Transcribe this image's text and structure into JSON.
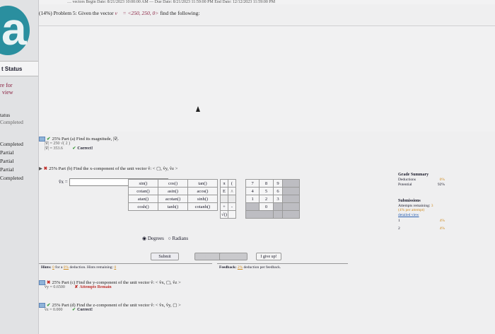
{
  "top_strip": "… vectors Begin Date: 8/21/2023 10:00:00 AM — Due Date: 8/21/2023 11:59:00 PM   End Date: 12/12/2023 11:59:00 PM",
  "sidebar": {
    "logo_letter": "a",
    "status_header": "t Status",
    "review_link_1": "re for",
    "review_link_2": "view",
    "status_label_1": "tatus",
    "status_label_2": "Completed",
    "items": [
      "Completed",
      "Partial",
      "Partial",
      "Partial",
      "Completed"
    ]
  },
  "problem": {
    "title_prefix": "(14%)  Problem 5:  Given the vector ",
    "vector_expr": "v⃗ = <250, 250, 0>",
    "title_suffix": " find the following:"
  },
  "parts": {
    "a": {
      "label": "25% Part (a)  Find its magnitude, |v⃗|.",
      "line1": "|v⃗| = 250 √( 2 )",
      "line2": "|v⃗| = 353.6",
      "status": "Correct!"
    },
    "b": {
      "label": "25% Part (b)  Find the x-component of the unit vector v̂: < ▢, v̂y, v̂z >",
      "answer_label": "v̂x = "
    },
    "c": {
      "label": "25% Part (c)  Find the y-component of the unit vector v̂: < v̂x, ▢, v̂z >",
      "line1": "v̂y = 0.6500",
      "status": "Attempts Remain"
    },
    "d": {
      "label": "25% Part (d)  Find the z-component of the unit vector v̂: < v̂x, v̂y, ▢ >",
      "line1": "v̂z = 0.000",
      "status": "Correct!"
    }
  },
  "keypad": {
    "functions": [
      [
        "sin()",
        "cos()",
        "tan()"
      ],
      [
        "cotan()",
        "asin()",
        "acos()"
      ],
      [
        "atan()",
        "acotan()",
        "sinh()"
      ],
      [
        "cosh()",
        "tanh()",
        "cotanh()"
      ]
    ],
    "symbols": [
      "π",
      "(",
      "E",
      "∧",
      "+",
      "-",
      "√()"
    ],
    "digits": [
      [
        "7",
        "8",
        "9"
      ],
      [
        "4",
        "5",
        "6"
      ],
      [
        "1",
        "2",
        "3"
      ],
      [
        "",
        "0",
        ""
      ]
    ],
    "extra": [
      "HOME",
      "END",
      "BACKSPACE",
      "DEL",
      "CLEAR"
    ],
    "angle_mode_selected": "Degrees",
    "angle_mode_other": "Radians"
  },
  "buttons": {
    "submit": "Submit",
    "hint": "Hint",
    "feedback": "Feedback",
    "give_up": "I give up!"
  },
  "hints": {
    "prefix": "Hints: ",
    "count": "0",
    "middle": " for a ",
    "percent": "0%",
    "suffix": " deduction. Hints remaining: ",
    "remaining": "0"
  },
  "feedback": {
    "prefix": "Feedback: ",
    "percent": "2%",
    "suffix": " deduction per feedback."
  },
  "grade_summary": {
    "title": "Grade Summary",
    "deductions_label": "Deductions",
    "deductions_value": "0%",
    "potential_label": "Potential",
    "potential_value": "92%"
  },
  "submissions": {
    "title": "Submissions",
    "attempts_label": "Attempts remaining: ",
    "attempts_value": "3",
    "per_attempt": "(4% per attempt)",
    "detailed_view": "detailed view",
    "rows": [
      [
        "1",
        "4%"
      ],
      [
        "2",
        "4%"
      ]
    ]
  },
  "colors": {
    "accent": "#2a8f9f",
    "correct": "#2a7a2a",
    "incorrect": "#c0302c",
    "highlight": "#d08a1c"
  }
}
